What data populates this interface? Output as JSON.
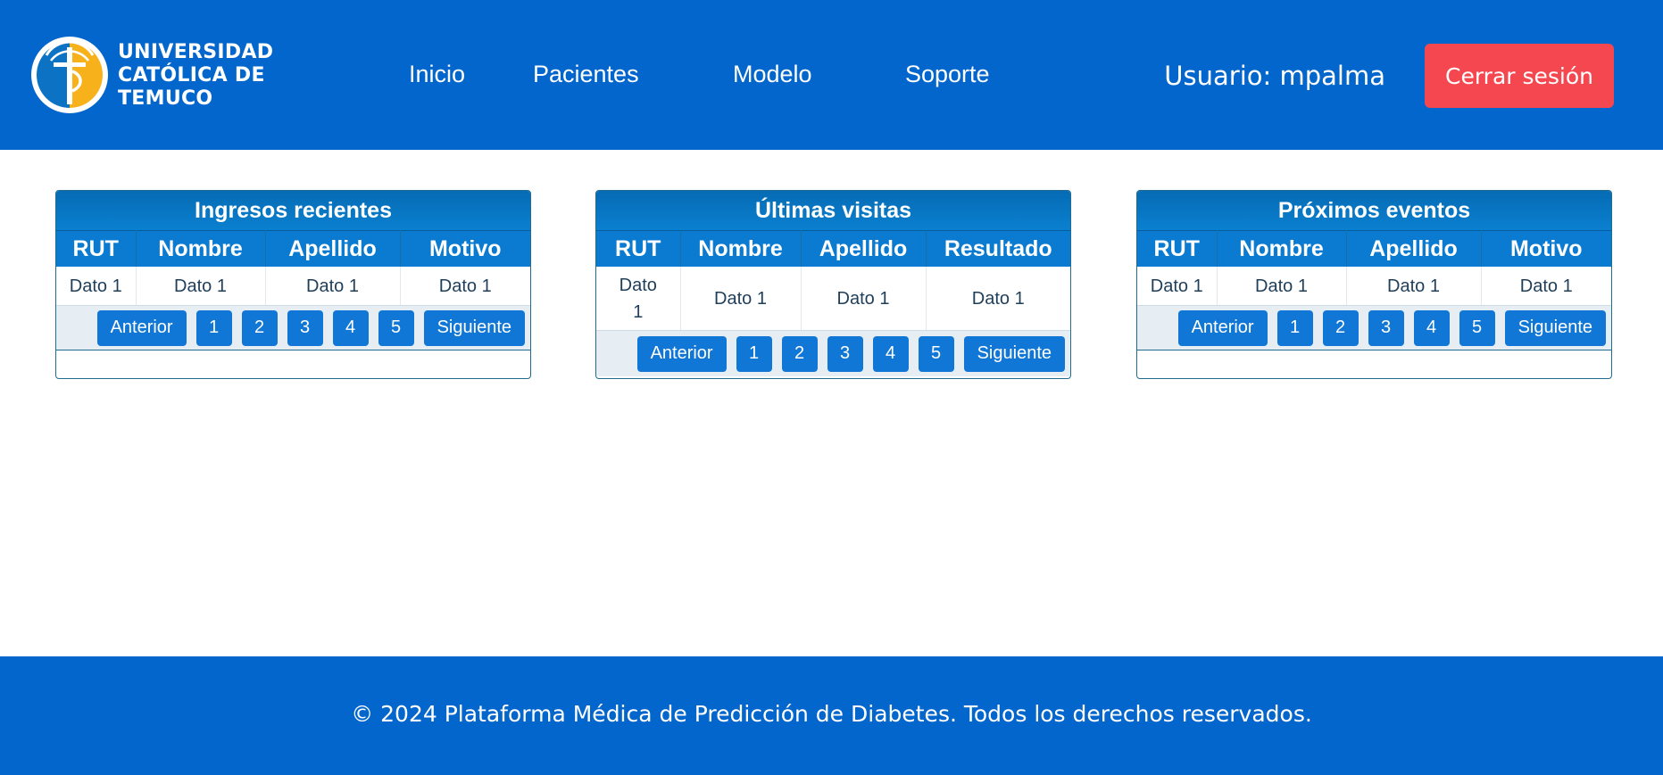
{
  "header": {
    "logo": {
      "line1": "UNIVERSIDAD",
      "line2": "CATÓLICA DE",
      "line3": "TEMUCO",
      "icon": "university-crest-icon"
    },
    "nav": [
      "Inicio",
      "Pacientes",
      "Modelo",
      "Soporte"
    ],
    "user_label": "Usuario: mpalma",
    "logout_label": "Cerrar sesión"
  },
  "panels": [
    {
      "title": "Ingresos recientes",
      "columns": [
        "RUT",
        "Nombre",
        "Apellido",
        "Motivo"
      ],
      "rows": [
        [
          "Dato 1",
          "Dato 1",
          "Dato 1",
          "Dato 1"
        ]
      ],
      "pagination": [
        "Anterior",
        "1",
        "2",
        "3",
        "4",
        "5",
        "Siguiente"
      ]
    },
    {
      "title": "Últimas visitas",
      "columns": [
        "RUT",
        "Nombre",
        "Apellido",
        "Resultado"
      ],
      "rows": [
        [
          "Dato 1",
          "Dato 1",
          "Dato 1",
          "Dato 1"
        ]
      ],
      "pagination": [
        "Anterior",
        "1",
        "2",
        "3",
        "4",
        "5",
        "Siguiente"
      ]
    },
    {
      "title": "Próximos eventos",
      "columns": [
        "RUT",
        "Nombre",
        "Apellido",
        "Motivo"
      ],
      "rows": [
        [
          "Dato 1",
          "Dato 1",
          "Dato 1",
          "Dato 1"
        ]
      ],
      "pagination": [
        "Anterior",
        "1",
        "2",
        "3",
        "4",
        "5",
        "Siguiente"
      ]
    }
  ],
  "footer": {
    "text": "© 2024 Plataforma Médica de Predicción de Diabetes. Todos los derechos reservados."
  },
  "colors": {
    "brand_blue": "#0366cc",
    "logout_red": "#f4474f",
    "table_header": "#0a7bd0",
    "pager_button": "#1177d6",
    "logo_yellow": "#f7b21b"
  }
}
